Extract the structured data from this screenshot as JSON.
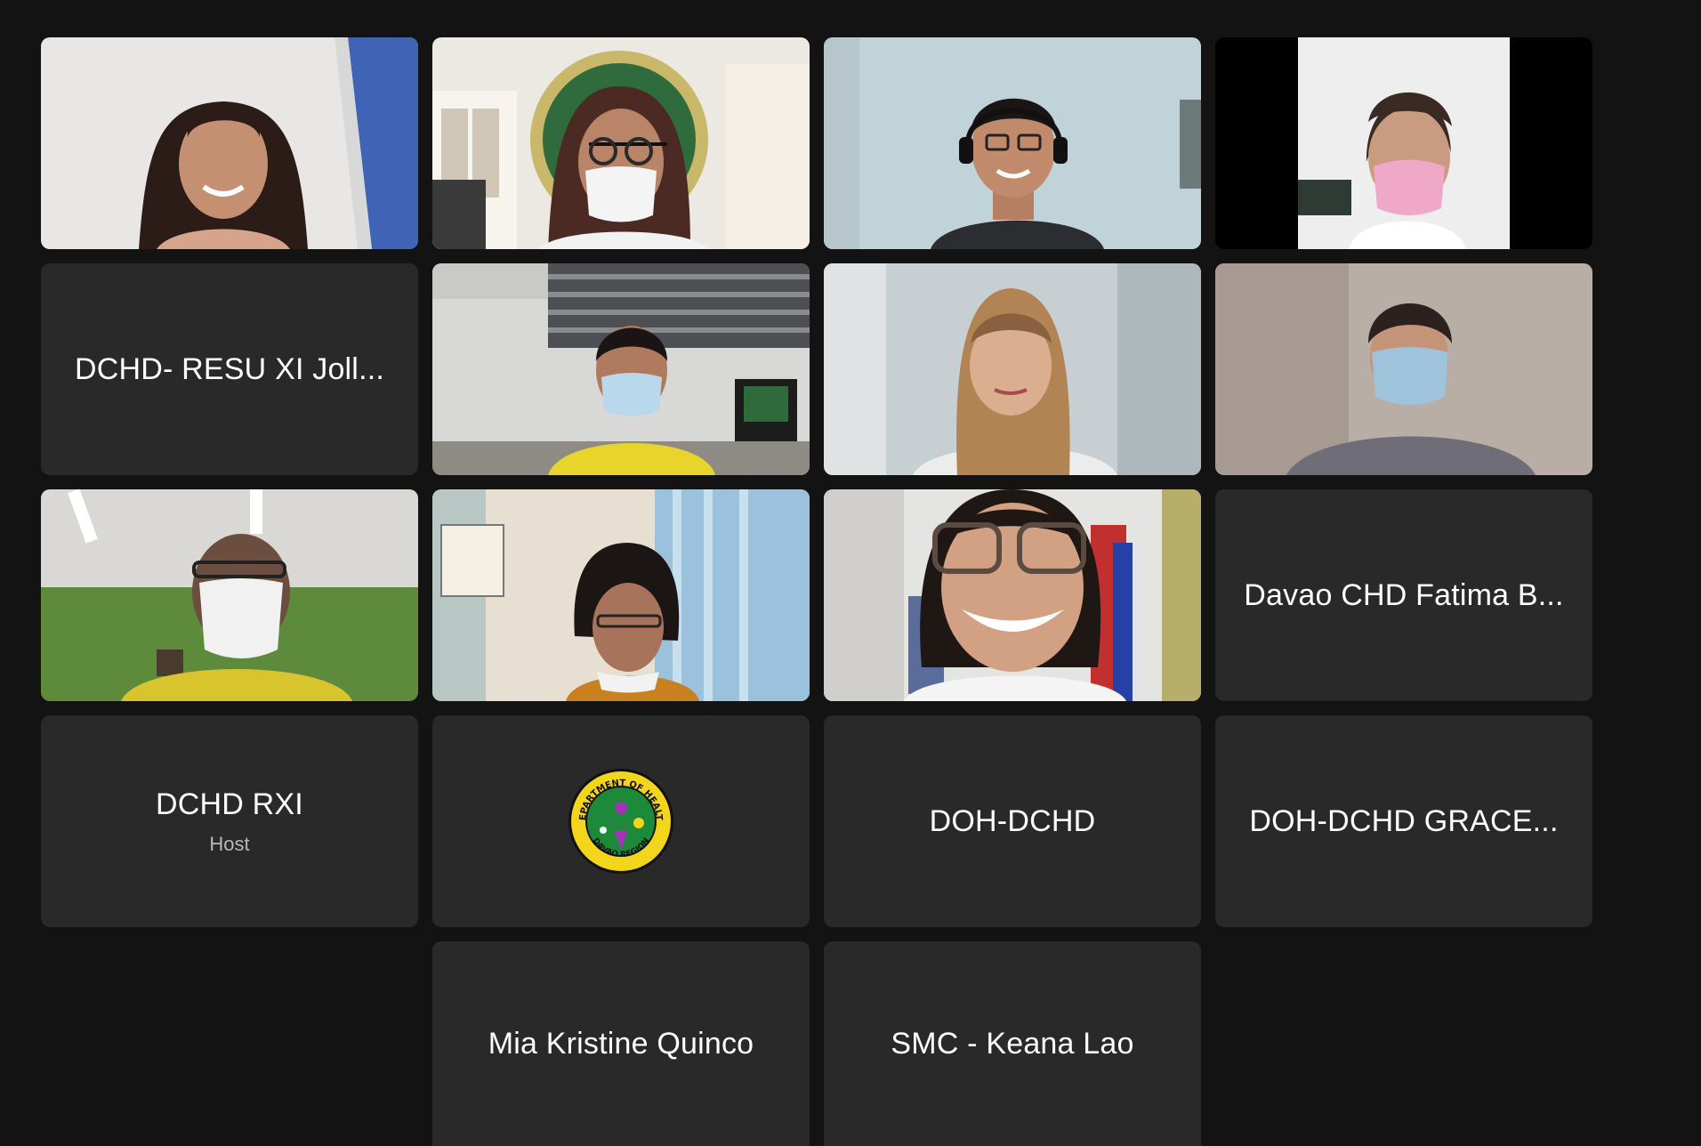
{
  "participants": [
    {
      "kind": "video",
      "subject": "woman-long-hair-smiling"
    },
    {
      "kind": "video",
      "subject": "woman-mask-glasses-doh-seal"
    },
    {
      "kind": "video",
      "subject": "man-headset-glasses"
    },
    {
      "kind": "video",
      "subject": "woman-pink-mask"
    },
    {
      "kind": "name",
      "name": "DCHD- RESU XI Joll..."
    },
    {
      "kind": "video",
      "subject": "man-mask-yellow-shirt-office"
    },
    {
      "kind": "video",
      "subject": "woman-blonde-highlights"
    },
    {
      "kind": "video",
      "subject": "man-blue-mask"
    },
    {
      "kind": "video",
      "subject": "person-mask-green-wall"
    },
    {
      "kind": "video",
      "subject": "woman-glasses-curtain"
    },
    {
      "kind": "video",
      "subject": "woman-glasses-smiling-closeup"
    },
    {
      "kind": "name",
      "name": "Davao CHD Fatima B..."
    },
    {
      "kind": "name",
      "name": "DCHD RXI",
      "role": "Host"
    },
    {
      "kind": "avatar",
      "logo": "doh-davao-region-seal",
      "seal_text_top": "DEPARTMENT OF HEALTH",
      "seal_text_bottom": "DAVAO REGION"
    },
    {
      "kind": "name",
      "name": "DOH-DCHD"
    },
    {
      "kind": "name",
      "name": "DOH-DCHD GRACE..."
    },
    {
      "kind": "name",
      "name": "Mia Kristine Quinco"
    },
    {
      "kind": "name",
      "name": "SMC - Keana Lao"
    }
  ],
  "colors": {
    "background": "#131313",
    "tile": "#292929",
    "name_text": "#ffffff",
    "role_text": "#b9b9b9"
  }
}
